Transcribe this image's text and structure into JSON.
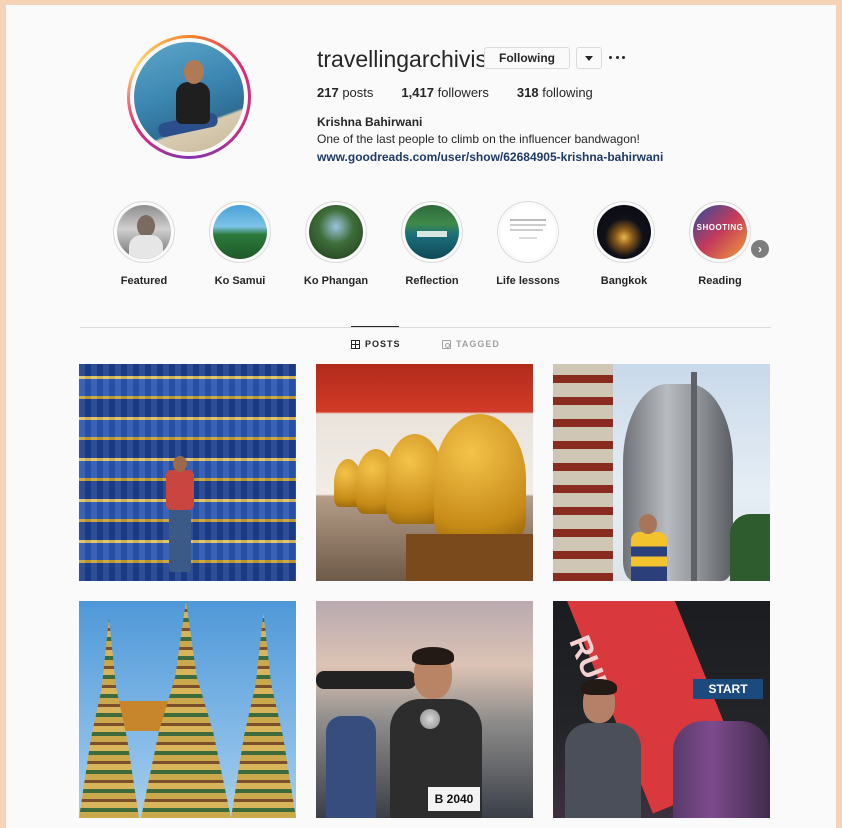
{
  "profile": {
    "username": "travellingarchivist",
    "following_button": "Following",
    "posts_count": "217",
    "posts_label": "posts",
    "followers_count": "1,417",
    "followers_label": "followers",
    "following_count": "318",
    "following_label": "following",
    "full_name": "Krishna Bahirwani",
    "bio": "One of the last people to climb on the influencer bandwagon!",
    "link": "www.goodreads.com/user/show/62684905-krishna-bahirwani"
  },
  "highlights": [
    {
      "label": "Featured"
    },
    {
      "label": "Ko Samui"
    },
    {
      "label": "Ko Phangan"
    },
    {
      "label": "Reflection"
    },
    {
      "label": "Life lessons"
    },
    {
      "label": "Bangkok"
    },
    {
      "label": "Reading",
      "overlay": "SHOOTING"
    }
  ],
  "tabs": {
    "posts": "POSTS",
    "tagged": "TAGGED"
  },
  "posts": [
    {
      "bib": ""
    },
    {
      "bib": ""
    },
    {
      "bib": ""
    },
    {
      "bib": ""
    },
    {
      "bib": "B 2040"
    },
    {
      "sign": "START",
      "banner": "RUN"
    }
  ],
  "colors": {
    "link": "#1e3a66",
    "text": "#262626",
    "border": "#dbdbdb",
    "background": "#fafafa",
    "frame": "#f6d2b6"
  }
}
